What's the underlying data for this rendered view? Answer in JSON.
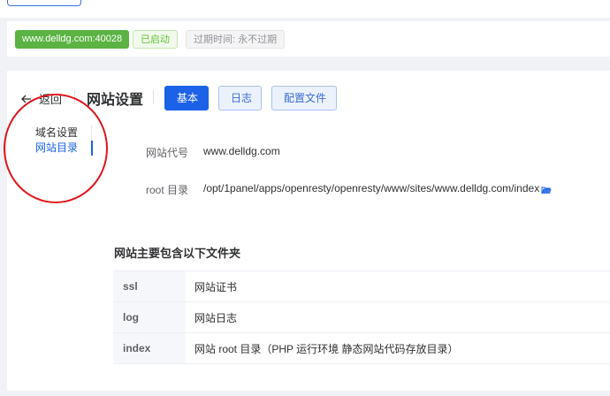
{
  "status_bar": {
    "domain_tag": "www.delldg.com:40028",
    "running_tag": "已启动",
    "expire_tag": "过期时间: 永不过期"
  },
  "header": {
    "back_label": "返回",
    "title": "网站设置",
    "tabs": [
      {
        "label": "基本",
        "active": true
      },
      {
        "label": "日志",
        "active": false
      },
      {
        "label": "配置文件",
        "active": false
      }
    ]
  },
  "side_menu": {
    "items": [
      {
        "label": "域名设置",
        "active": false
      },
      {
        "label": "网站目录",
        "active": true
      }
    ]
  },
  "form": {
    "alias_label": "网站代号",
    "alias_value": "www.delldg.com",
    "root_label": "root 目录",
    "root_value": "/opt/1panel/apps/openresty/openresty/www/sites/www.delldg.com/index"
  },
  "folders_section": {
    "title": "网站主要包含以下文件夹",
    "rows": [
      {
        "name": "ssl",
        "description": "网站证书"
      },
      {
        "name": "log",
        "description": "网站日志"
      },
      {
        "name": "index",
        "description": "网站 root 目录（PHP 运行环境 静态网站代码存放目录）"
      }
    ]
  },
  "colors": {
    "primary": "#1c62e8",
    "success": "#5ab342",
    "annotation": "#e0141b"
  },
  "icons": {
    "back": "arrow-left-icon",
    "folder": "folder-open-icon"
  }
}
